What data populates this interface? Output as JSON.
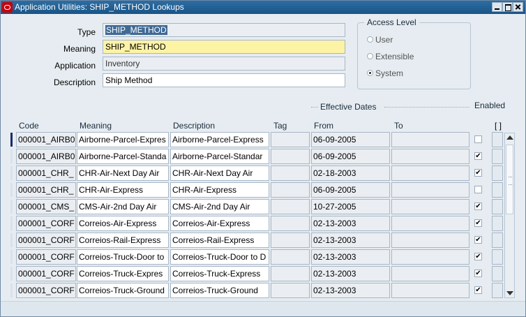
{
  "window": {
    "title": "Application Utilities: SHIP_METHOD Lookups"
  },
  "header": {
    "type_label": "Type",
    "type_value": "SHIP_METHOD",
    "meaning_label": "Meaning",
    "meaning_value": "SHIP_METHOD",
    "application_label": "Application",
    "application_value": "Inventory",
    "description_label": "Description",
    "description_value": "Ship Method"
  },
  "access_level": {
    "title": "Access Level",
    "options": [
      {
        "label": "User",
        "selected": false
      },
      {
        "label": "Extensible",
        "selected": false
      },
      {
        "label": "System",
        "selected": true
      }
    ]
  },
  "table": {
    "effective_dates_label": "Effective Dates",
    "enabled_label": "Enabled",
    "context_header": "[ ]",
    "columns": {
      "code": "Code",
      "meaning": "Meaning",
      "description": "Description",
      "tag": "Tag",
      "from": "From",
      "to": "To"
    },
    "rows": [
      {
        "code": "000001_AIRB0",
        "meaning": "Airborne-Parcel-Expres",
        "description": "Airborne-Parcel-Express",
        "tag": "",
        "from": "06-09-2005",
        "to": "",
        "enabled": false
      },
      {
        "code": "000001_AIRB0",
        "meaning": "Airborne-Parcel-Standa",
        "description": "Airborne-Parcel-Standar",
        "tag": "",
        "from": "06-09-2005",
        "to": "",
        "enabled": true
      },
      {
        "code": "000001_CHR_",
        "meaning": "CHR-Air-Next Day Air",
        "description": "CHR-Air-Next Day Air",
        "tag": "",
        "from": "02-18-2003",
        "to": "",
        "enabled": true
      },
      {
        "code": "000001_CHR_",
        "meaning": "CHR-Air-Express",
        "description": "CHR-Air-Express",
        "tag": "",
        "from": "06-09-2005",
        "to": "",
        "enabled": false
      },
      {
        "code": "000001_CMS_",
        "meaning": "CMS-Air-2nd Day Air",
        "description": "CMS-Air-2nd Day Air",
        "tag": "",
        "from": "10-27-2005",
        "to": "",
        "enabled": true
      },
      {
        "code": "000001_CORF",
        "meaning": "Correios-Air-Express",
        "description": "Correios-Air-Express",
        "tag": "",
        "from": "02-13-2003",
        "to": "",
        "enabled": true
      },
      {
        "code": "000001_CORF",
        "meaning": "Correios-Rail-Express",
        "description": "Correios-Rail-Express",
        "tag": "",
        "from": "02-13-2003",
        "to": "",
        "enabled": true
      },
      {
        "code": "000001_CORF",
        "meaning": "Correios-Truck-Door to",
        "description": "Correios-Truck-Door to D",
        "tag": "",
        "from": "02-13-2003",
        "to": "",
        "enabled": true
      },
      {
        "code": "000001_CORF",
        "meaning": "Correios-Truck-Expres",
        "description": "Correios-Truck-Express",
        "tag": "",
        "from": "02-13-2003",
        "to": "",
        "enabled": true
      },
      {
        "code": "000001_CORF",
        "meaning": "Correios-Truck-Ground",
        "description": "Correios-Truck-Ground",
        "tag": "",
        "from": "02-13-2003",
        "to": "",
        "enabled": true
      }
    ]
  }
}
